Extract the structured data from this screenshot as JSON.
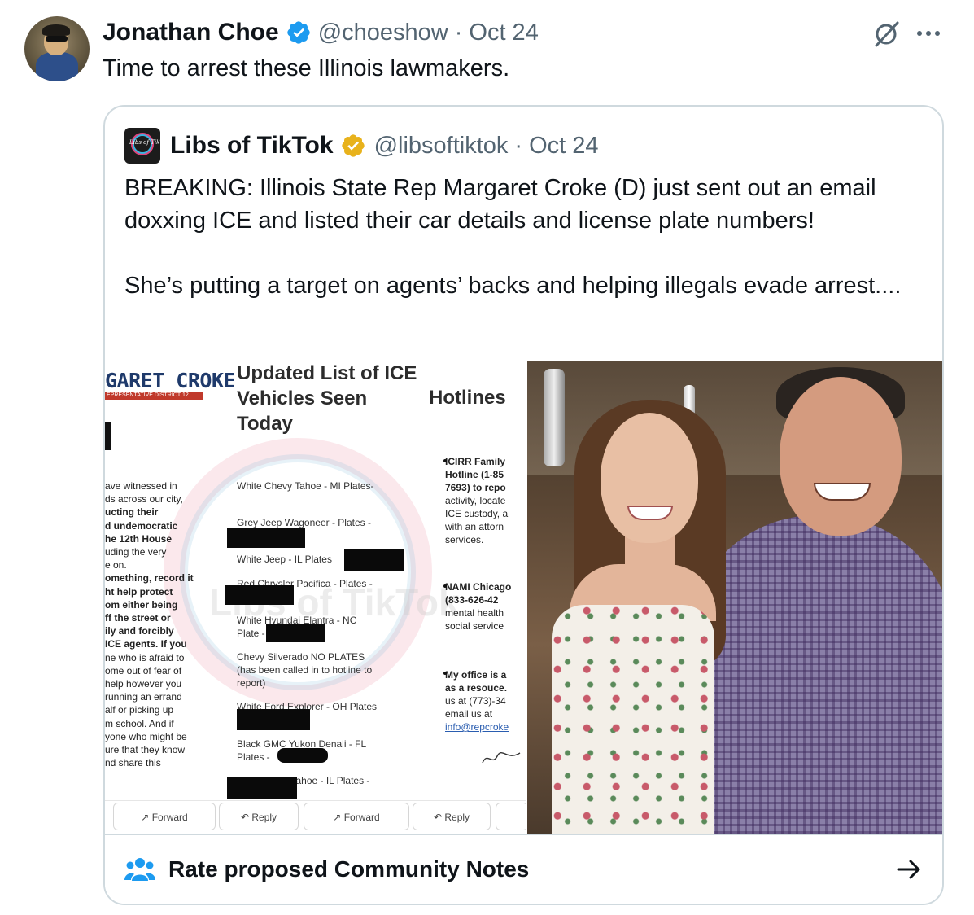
{
  "tweet": {
    "author_name": "Jonathan Choe",
    "handle": "@choeshow",
    "separator": "·",
    "date": "Oct 24",
    "text": "Time to arrest these Illinois lawmakers.",
    "verified_color": "#1d9bf0"
  },
  "quoted_tweet": {
    "author_name": "Libs of TikTok",
    "handle": "@libsoftiktok",
    "separator": "·",
    "date": "Oct 24",
    "verified_color": "#e8b21c",
    "text_paragraphs": [
      "BREAKING: Illinois State Rep Margaret Croke (D) just sent out an email doxxing ICE and listed their car details and license plate numbers!",
      "She’s putting a target on agents’ backs and helping illegals evade arrest...."
    ],
    "avatar_text": "Libs of TikTok"
  },
  "document_image": {
    "header_name": "GARET CROKE",
    "header_district": "EPRESENTATIVE DISTRICT 12",
    "title": "Updated List of ICE Vehicles Seen Today",
    "hotlines_title": "Hotlines",
    "watermark": "Libs of TikTok",
    "left_column_lines": [
      "ave witnessed in",
      "ds across our city,",
      "ucting their",
      "d undemocratic",
      "he 12th House",
      "uding the very",
      "e on.",
      "",
      "",
      "",
      "omething, record it",
      "ht help protect",
      "om either being",
      "ff the street or",
      "ily and forcibly",
      "ICE agents. If you",
      "ne who is afraid to",
      "ome out of fear of",
      " help however you",
      " running an errand",
      "alf or picking up",
      "m school. And if",
      "yone who might be",
      "ure that they know",
      "nd share this"
    ],
    "vehicles": [
      "White Chevy Tahoe - MI Plates-",
      "Grey Jeep Wagoneer - Plates -",
      "White Jeep - IL Plates",
      "Red Chrysler Pacifica - Plates -",
      "White Hyundai Elantra - NC",
      "Plate -",
      "Chevy Silverado NO PLATES",
      "(has been called in to hotline to",
      "report)",
      "White Ford Explorer - OH Plates",
      "Black GMC Yukon Denali - FL",
      "Plates -",
      "Grey Chevy Tahoe - IL Plates -"
    ],
    "hotlines": [
      "ICIRR Family",
      "Hotline (1-85",
      "7693) to repo",
      "activity, locate",
      "ICE custody, a",
      "with an attorn",
      "services.",
      "NAMI Chicago",
      "(833-626-42",
      "mental health",
      "social service",
      "My office is a",
      "as a resouce.",
      "us at (773)-34",
      "email us at",
      "info@repcroke"
    ],
    "email_buttons": [
      "Forward",
      "Reply",
      "Forward",
      "Reply"
    ],
    "forward_glyph": "↗",
    "reply_glyph": "↶"
  },
  "community_notes": {
    "label": "Rate proposed Community Notes",
    "icon": "people-icon",
    "arrow": "arrow-right-icon",
    "icon_color": "#1d9bf0"
  },
  "icons": {
    "grok": "grok-icon",
    "more": "more-icon"
  }
}
